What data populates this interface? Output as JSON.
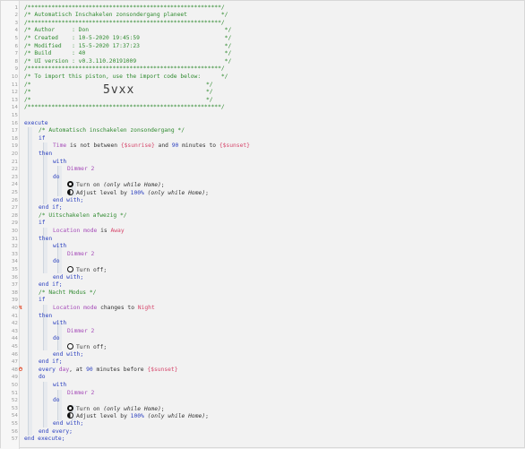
{
  "line_numbers": [
    "1",
    "2",
    "3",
    "4",
    "5",
    "6",
    "7",
    "8",
    "9",
    "10",
    "11",
    "12",
    "13",
    "14",
    "15",
    "16",
    "17",
    "18",
    "19",
    "20",
    "21",
    "22",
    "23",
    "24",
    "25",
    "26",
    "27",
    "28",
    "29",
    "30",
    "31",
    "32",
    "33",
    "34",
    "35",
    "36",
    "37",
    "38",
    "39",
    "40",
    "41",
    "42",
    "43",
    "44",
    "45",
    "46",
    "47",
    "48",
    "49",
    "50",
    "51",
    "52",
    "53",
    "54",
    "55",
    "56",
    "57"
  ],
  "markers": {
    "line40": "↯",
    "line48": "⏱"
  },
  "header": {
    "border": "/*********************************************************/",
    "title": "/* Automatisch Inschakelen zonsondergang planeet          */",
    "author": "/* Author     : Don                                        */",
    "created": "/* Created    : 10-5-2020 19:45:59                         */",
    "modified": "/* Modified   : 15-5-2020 17:37:23                         */",
    "build": "/* Build      : 40                                         */",
    "version": "/* UI version : v0.3.110.20191009                          */",
    "import_note": "/* To import this piston, use the import code below:      */",
    "blank_open": "/*",
    "blank_close": "*/",
    "import_code": "5vxx"
  },
  "code": {
    "execute": "execute",
    "c1": "/* Automatisch inschakelen zonsondergang */",
    "if": "if",
    "time_subject": "Time",
    "is_not_between": " is not between ",
    "sunrise": "{$sunrise}",
    "and": " and ",
    "ninety": "90",
    "minutes_to": " minutes to ",
    "sunset": "{$sunset}",
    "then": "then",
    "with": "with",
    "dimmer": "Dimmer 2",
    "do": "do",
    "turn_on": "Turn on ",
    "only_while_home": "(only while Home)",
    "semi": ";",
    "adjust_level": "Adjust level by ",
    "hundred_pct": "100%",
    "end_with": "end with;",
    "end_if": "end if;",
    "c2": "/* Uitschakelen afwezig */",
    "location_mode": "Location mode",
    "is": " is ",
    "away": "Away",
    "turn_off": "Turn off;",
    "c3": "/* Nacht Modus */",
    "changes_to": " changes to ",
    "night": "Night",
    "every_day_a": "every ",
    "day": "day",
    "every_day_b": ", at ",
    "minutes_before": " minutes before ",
    "end_every": "end every;",
    "end_execute": "end execute;"
  }
}
